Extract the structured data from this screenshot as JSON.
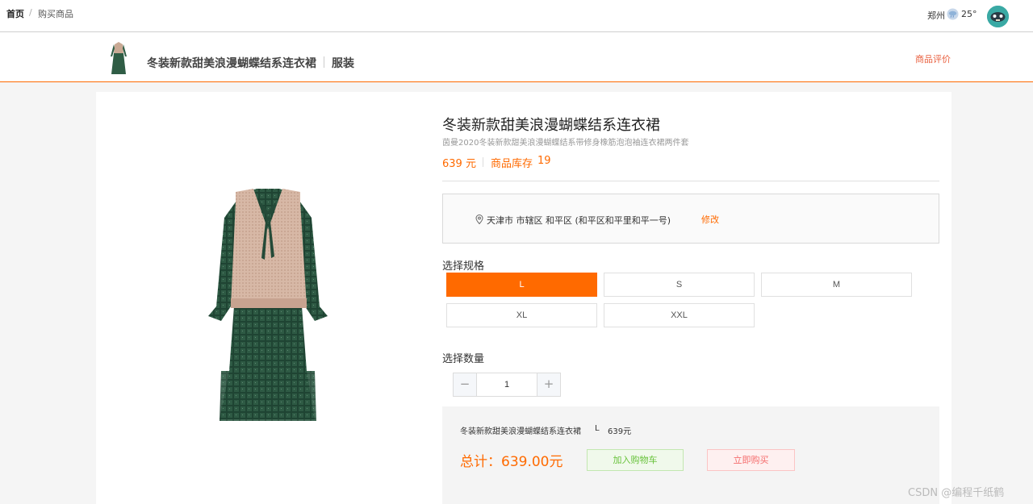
{
  "breadcrumb": {
    "home": "首页",
    "separator": "/",
    "current": "购买商品"
  },
  "header_right": {
    "city": "郑州",
    "weather_icon": "cloud-rain-icon",
    "temperature": "25°"
  },
  "product_bar": {
    "name": "冬装新款甜美浪漫蝴蝶结系连衣裙",
    "category": "服装",
    "review_link": "商品评价"
  },
  "product": {
    "title": "冬装新款甜美浪漫蝴蝶结系连衣裙",
    "subtitle": "茵曼2020冬装新款甜美浪漫蝴蝶结系带修身橡筋泡泡袖连衣裙两件套",
    "price": "639 元",
    "stock_label": "商品库存",
    "stock_value": "19"
  },
  "address": {
    "text": "天津市 市辖区 和平区 (和平区和平里和平一号)",
    "edit_label": "修改"
  },
  "spec": {
    "label": "选择规格",
    "sizes": [
      "L",
      "S",
      "M",
      "XL",
      "XXL"
    ],
    "selected": "L"
  },
  "quantity": {
    "label": "选择数量",
    "value": "1",
    "minus": "−",
    "plus": "+"
  },
  "summary": {
    "name": "冬装新款甜美浪漫蝴蝶结系连衣裙",
    "size": "L",
    "price": "639元",
    "total": "总计：639.00元",
    "add_to_cart": "加入购物车",
    "buy_now": "立即购买"
  },
  "watermark": "CSDN @编程千纸鹤",
  "colors": {
    "accent": "#ff6a00",
    "success": "#67c23a",
    "danger": "#f56c6c"
  }
}
